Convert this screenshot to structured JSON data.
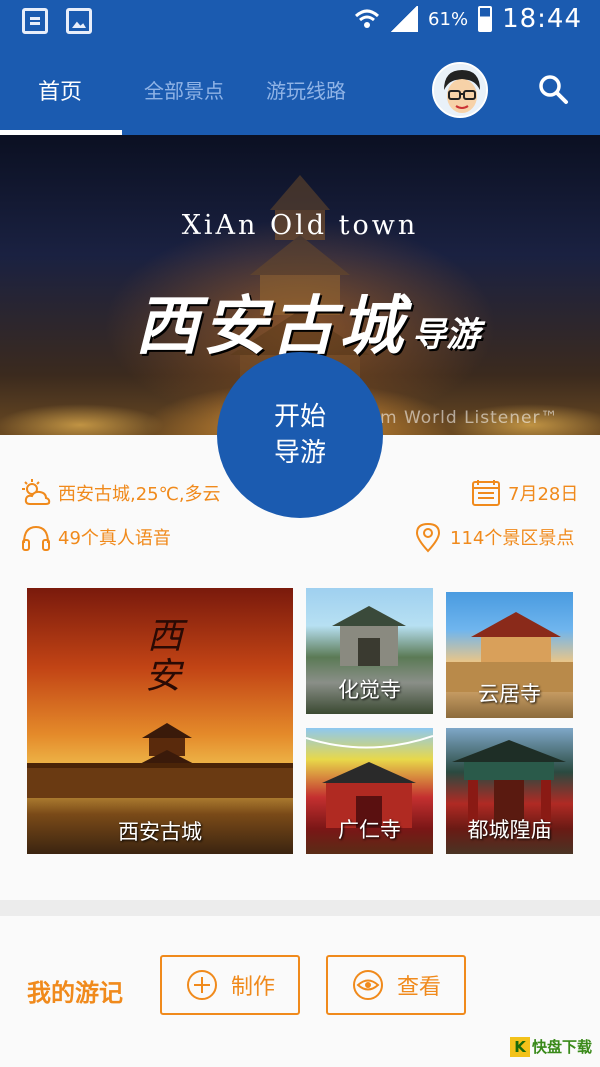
{
  "status_bar": {
    "battery": "61%",
    "time": "18:44"
  },
  "tabs": [
    {
      "label": "首页",
      "active": true
    },
    {
      "label": "全部景点",
      "active": false
    },
    {
      "label": "游玩线路",
      "active": false
    }
  ],
  "banner": {
    "en_title": "XiAn Old town",
    "cn_title": "西安古城",
    "cn_subtitle": "导游",
    "credit": "m World Listener™"
  },
  "start_button": {
    "line1": "开始",
    "line2": "导游"
  },
  "info": {
    "weather": "西安古城,25℃,多云",
    "date": "7月28日",
    "voices": "49个真人语音",
    "spots": "114个景区景点"
  },
  "attractions": [
    {
      "name": "西安古城"
    },
    {
      "name": "化觉寺"
    },
    {
      "name": "云居寺"
    },
    {
      "name": "广仁寺"
    },
    {
      "name": "都城隍庙"
    }
  ],
  "my_travel": {
    "title": "我的游记",
    "create_label": "制作",
    "view_label": "查看"
  },
  "watermark": {
    "k": "K",
    "text": "快盘下载"
  },
  "colors": {
    "primary": "#1b5bb0",
    "accent": "#f08a1c"
  }
}
